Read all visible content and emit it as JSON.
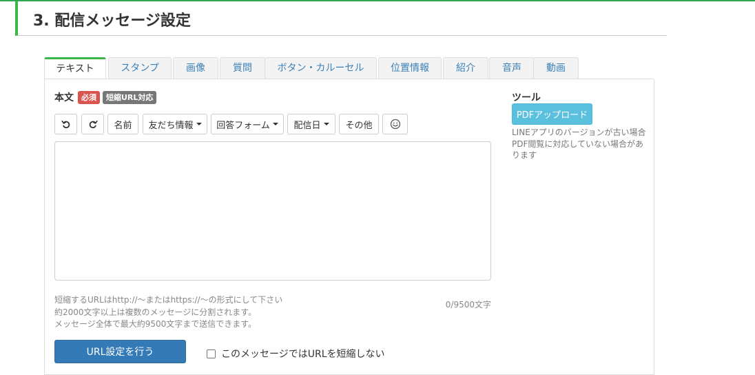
{
  "section": {
    "title": "3. 配信メッセージ設定"
  },
  "tabs": [
    {
      "label": "テキスト",
      "active": true
    },
    {
      "label": "スタンプ"
    },
    {
      "label": "画像"
    },
    {
      "label": "質問"
    },
    {
      "label": "ボタン・カルーセル"
    },
    {
      "label": "位置情報"
    },
    {
      "label": "紹介"
    },
    {
      "label": "音声"
    },
    {
      "label": "動画"
    }
  ],
  "body": {
    "label": "本文",
    "badge_required": "必須",
    "badge_shorturl": "短縮URL対応"
  },
  "toolbar": {
    "undo_icon": "undo-icon",
    "redo_icon": "redo-icon",
    "name": "名前",
    "friend_info": "友だち情報",
    "answer_form": "回答フォーム",
    "delivery_date": "配信日",
    "other": "その他",
    "emoji_icon": "smiley-icon"
  },
  "message": {
    "value": ""
  },
  "help": {
    "line1": "短縮するURLはhttp://～またはhttps://～の形式にして下さい",
    "line2": "約2000文字以上は複数のメッセージに分割されます。",
    "line3": "メッセージ全体で最大約9500文字まで送信できます。"
  },
  "counter": "0/9500文字",
  "actions": {
    "url_button": "URL設定を行う",
    "no_shorten_label": "このメッセージではURLを短縮しない",
    "no_shorten_checked": false
  },
  "tools": {
    "title": "ツール",
    "pdf_button": "PDFアップロード",
    "note": "LINEアプリのバージョンが古い場合PDF閲覧に対応していない場合があります"
  },
  "colors": {
    "accent_green": "#3cb54a",
    "primary_blue": "#337ab7",
    "info_blue": "#5bc0de",
    "danger_red": "#d9534f",
    "tab_link": "#3a80b8"
  }
}
